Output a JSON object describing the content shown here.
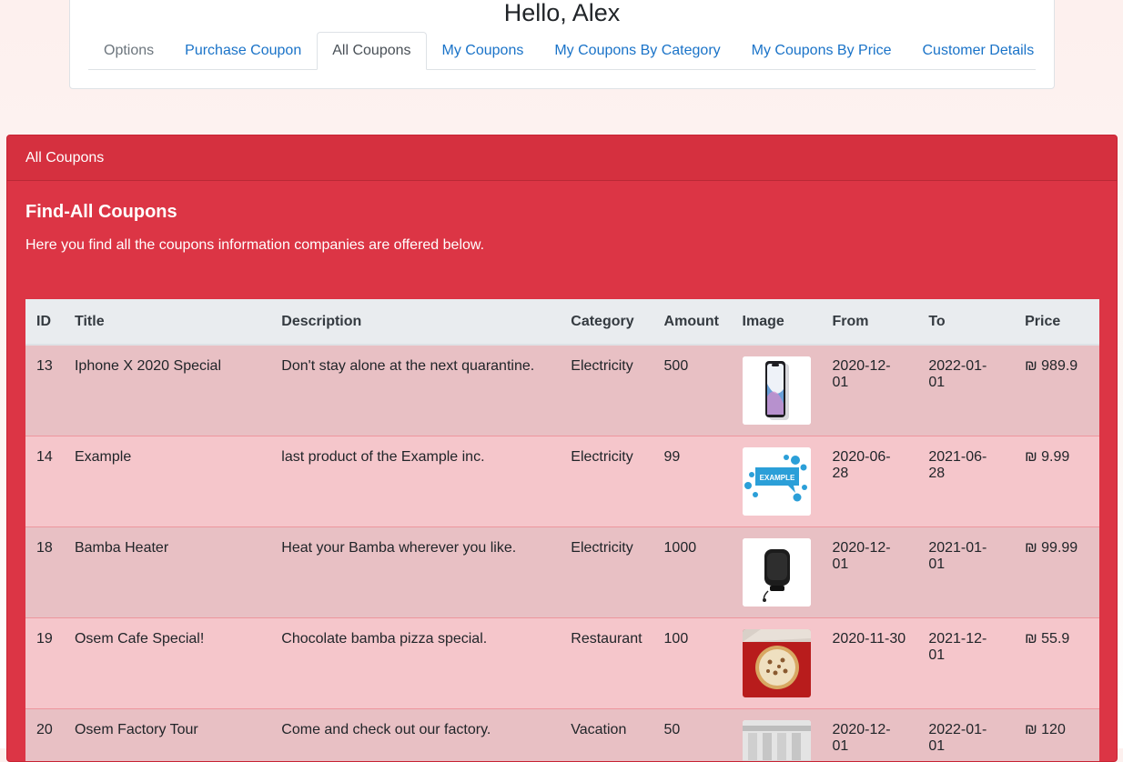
{
  "greeting": "Hello, Alex",
  "tabs": [
    {
      "label": "Options"
    },
    {
      "label": "Purchase Coupon"
    },
    {
      "label": "All Coupons"
    },
    {
      "label": "My Coupons"
    },
    {
      "label": "My Coupons By Category"
    },
    {
      "label": "My Coupons By Price"
    },
    {
      "label": "Customer Details"
    }
  ],
  "panel": {
    "header": "All Coupons",
    "title": "Find-All Coupons",
    "description": "Here you find all the coupons information companies are offered below."
  },
  "table": {
    "columns": [
      "ID",
      "Title",
      "Description",
      "Category",
      "Amount",
      "Image",
      "From",
      "To",
      "Price"
    ],
    "rows": [
      {
        "id": "13",
        "title": "Iphone X 2020 Special",
        "description": "Don't stay alone at the next quarantine.",
        "category": "Electricity",
        "amount": "500",
        "image": "phone-image",
        "from": "2020-12-01",
        "to": "2022-01-01",
        "price": "₪ 989.9"
      },
      {
        "id": "14",
        "title": "Example",
        "description": "last product of the Example inc.",
        "category": "Electricity",
        "amount": "99",
        "image": "example-logo-image",
        "example_text": "EXAMPLE",
        "from": "2020-06-28",
        "to": "2021-06-28",
        "price": "₪ 9.99"
      },
      {
        "id": "18",
        "title": "Bamba Heater",
        "description": "Heat your Bamba wherever you like.",
        "category": "Electricity",
        "amount": "1000",
        "image": "heater-image",
        "from": "2020-12-01",
        "to": "2021-01-01",
        "price": "₪ 99.99"
      },
      {
        "id": "19",
        "title": "Osem Cafe Special!",
        "description": "Chocolate bamba pizza special.",
        "category": "Restaurant",
        "amount": "100",
        "image": "pizza-image",
        "from": "2020-11-30",
        "to": "2021-12-01",
        "price": "₪ 55.9"
      },
      {
        "id": "20",
        "title": "Osem Factory Tour",
        "description": "Come and check out our factory.",
        "category": "Vacation",
        "amount": "50",
        "image": "factory-image",
        "from": "2020-12-01",
        "to": "2022-01-01",
        "price": "₪ 120"
      }
    ]
  },
  "colors": {
    "panel": "#dc3545",
    "link": "#1a73c8",
    "row_odd": "#e8c0c4",
    "row_even": "#f5c6cb"
  }
}
